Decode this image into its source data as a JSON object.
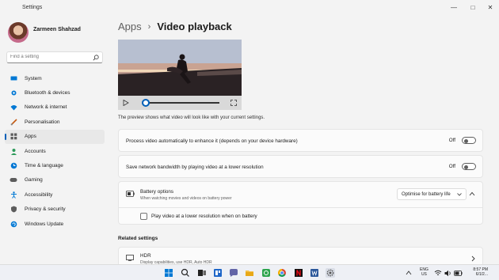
{
  "window": {
    "title": "Settings",
    "controls": [
      "—",
      "□",
      "✕"
    ]
  },
  "profile": {
    "name": "Zarmeen Shahzad"
  },
  "search": {
    "placeholder": "Find a setting"
  },
  "sidebar": {
    "items": [
      {
        "label": "System",
        "icon": "system-icon",
        "color": "#0078d4"
      },
      {
        "label": "Bluetooth & devices",
        "icon": "bluetooth-icon",
        "color": "#0078d4"
      },
      {
        "label": "Network & internet",
        "icon": "network-icon",
        "color": "#0078d4"
      },
      {
        "label": "Personalisation",
        "icon": "brush-icon",
        "color": "#c55a11"
      },
      {
        "label": "Apps",
        "icon": "apps-icon",
        "color": "#5c5c5c",
        "active": true
      },
      {
        "label": "Accounts",
        "icon": "accounts-icon",
        "color": "#2d9a5a"
      },
      {
        "label": "Time & language",
        "icon": "time-language-icon",
        "color": "#0078d4"
      },
      {
        "label": "Gaming",
        "icon": "gaming-icon",
        "color": "#5c5c5c"
      },
      {
        "label": "Accessibility",
        "icon": "accessibility-icon",
        "color": "#0078d4"
      },
      {
        "label": "Privacy & security",
        "icon": "shield-icon",
        "color": "#5c5c5c"
      },
      {
        "label": "Windows Update",
        "icon": "windows-update-icon",
        "color": "#0078d4"
      }
    ]
  },
  "breadcrumb": {
    "parent": "Apps",
    "separator": "›",
    "current": "Video playback"
  },
  "preview": {
    "note": "The preview shows what video will look like with your current settings.",
    "progress": 0.02
  },
  "settings": {
    "process_video": {
      "label": "Process video automatically to enhance it (depends on your device hardware)",
      "state": "Off"
    },
    "save_bandwidth": {
      "label": "Save network bandwidth by playing video at a lower resolution",
      "state": "Off"
    },
    "battery": {
      "title": "Battery options",
      "description": "When watching movies and videos on battery power",
      "selected": "Optimise for battery life",
      "checkbox_label": "Play video at a lower resolution when on battery"
    }
  },
  "related": {
    "heading": "Related settings",
    "hdr": {
      "title": "HDR",
      "description": "Display capabilities, use HDR, Auto HDR"
    }
  },
  "taskbar": {
    "lang_line1": "ENG",
    "lang_line2": "US",
    "time": "8:57 PM",
    "date": "6/1/2..."
  }
}
